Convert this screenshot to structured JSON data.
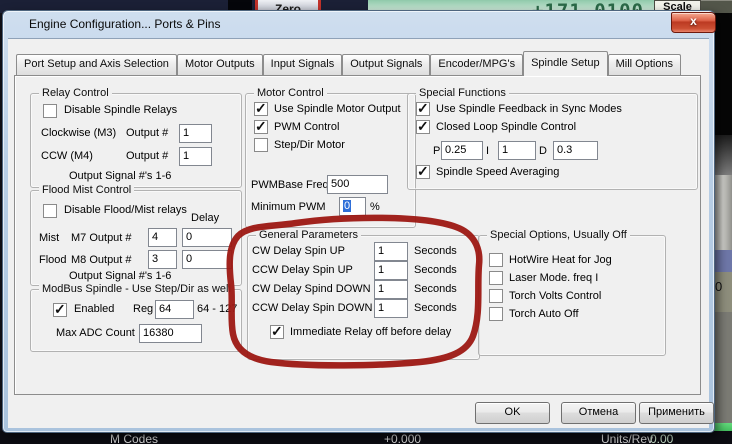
{
  "background": {
    "zero_button_label": "Zero",
    "dro_value": "+171.0100",
    "scale_label": "Scale",
    "right_panel_digit": "0",
    "bottom": {
      "m_codes_label": "M Codes",
      "dro_small_value": "+0.000",
      "units_rev_label": "Units/Rev",
      "units_rev_value": "0.00"
    }
  },
  "dialog": {
    "title": "Engine Configuration... Ports & Pins",
    "close_glyph": "x",
    "tabs": [
      {
        "label": "Port Setup and Axis Selection"
      },
      {
        "label": "Motor Outputs"
      },
      {
        "label": "Input Signals"
      },
      {
        "label": "Output Signals"
      },
      {
        "label": "Encoder/MPG's"
      },
      {
        "label": "Spindle Setup"
      },
      {
        "label": "Mill Options"
      }
    ],
    "active_tab": "Spindle Setup",
    "buttons": {
      "ok": "OK",
      "cancel": "Отмена",
      "apply": "Применить"
    }
  },
  "relay_control": {
    "title": "Relay Control",
    "disable_label": "Disable Spindle Relays",
    "disable_checked": false,
    "rows": [
      {
        "label": "Clockwise (M3)",
        "output_label": "Output #",
        "value": "1"
      },
      {
        "label": "CCW (M4)",
        "output_label": "Output #",
        "value": "1"
      }
    ],
    "footer": "Output Signal #'s 1-6"
  },
  "flood_mist": {
    "title": "Flood Mist Control",
    "disable_label": "Disable Flood/Mist relays",
    "disable_checked": false,
    "delay_header": "Delay",
    "rows": [
      {
        "label": "Mist",
        "output_label": "M7 Output #",
        "value": "4",
        "delay": "0"
      },
      {
        "label": "Flood",
        "output_label": "M8 Output #",
        "value": "3",
        "delay": "0"
      }
    ],
    "footer": "Output Signal #'s 1-6"
  },
  "modbus": {
    "title": "ModBus Spindle - Use Step/Dir as well",
    "enabled_label": "Enabled",
    "enabled_checked": true,
    "reg_label": "Reg",
    "reg_value": "64",
    "reg_range": "64 - 127",
    "adc_label": "Max ADC Count",
    "adc_value": "16380"
  },
  "motor_control": {
    "title": "Motor Control",
    "checks": [
      {
        "label": "Use Spindle Motor Output",
        "checked": true
      },
      {
        "label": "PWM Control",
        "checked": true
      },
      {
        "label": "Step/Dir Motor",
        "checked": false
      }
    ],
    "pwmbase_label": "PWMBase Freq.",
    "pwmbase_value": "500",
    "minpwm_label": "Minimum PWM",
    "minpwm_value": "0",
    "minpwm_unit": "%"
  },
  "special_functions": {
    "title": "Special Functions",
    "feedback_label": "Use Spindle Feedback in Sync Modes",
    "feedback_checked": true,
    "closedloop_label": "Closed Loop Spindle Control",
    "closedloop_checked": true,
    "p_label": "P",
    "p_value": "0.25",
    "i_label": "I",
    "i_value": "1",
    "d_label": "D",
    "d_value": "0.3",
    "averaging_label": "Spindle Speed Averaging",
    "averaging_checked": true
  },
  "general_parameters": {
    "title": "General Parameters",
    "rows": [
      {
        "label": "CW Delay Spin UP",
        "value": "1",
        "unit": "Seconds"
      },
      {
        "label": "CCW Delay Spin UP",
        "value": "1",
        "unit": "Seconds"
      },
      {
        "label": "CW Delay Spind DOWN",
        "value": "1",
        "unit": "Seconds"
      },
      {
        "label": "CCW Delay Spin DOWN",
        "value": "1",
        "unit": "Seconds"
      }
    ],
    "immediate_label": "Immediate Relay off before delay",
    "immediate_checked": true
  },
  "special_options": {
    "title": "Special Options, Usually Off",
    "checks": [
      {
        "label": "HotWire Heat for Jog",
        "checked": false
      },
      {
        "label": "Laser Mode. freq I",
        "checked": false
      },
      {
        "label": "Torch Volts Control",
        "checked": false
      },
      {
        "label": "Torch Auto Off",
        "checked": false
      }
    ]
  },
  "annotation": {
    "color": "#9c1712",
    "shape": "hand-drawn ellipse",
    "target": "General Parameters"
  }
}
